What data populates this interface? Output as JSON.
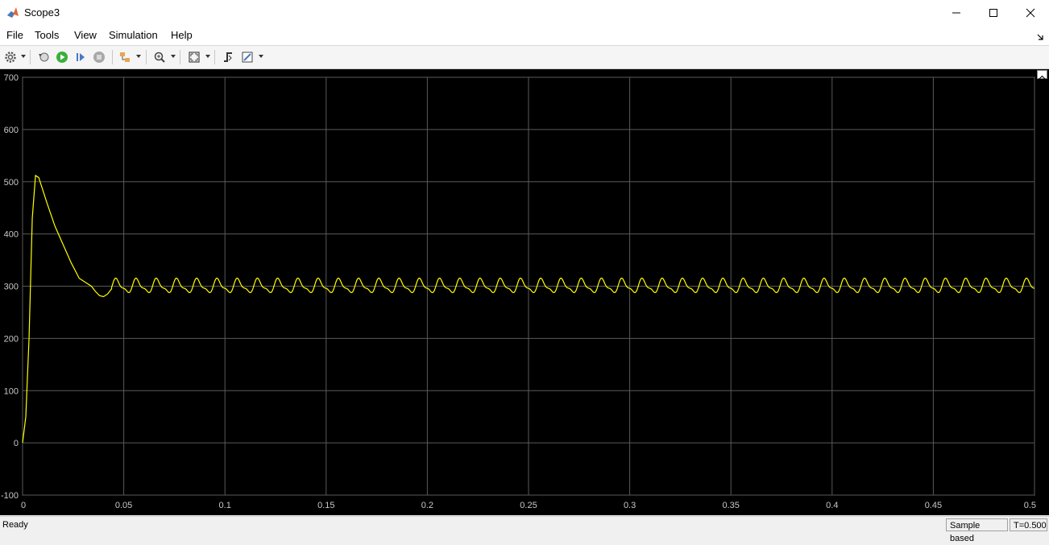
{
  "window": {
    "title": "Scope3"
  },
  "menu": [
    "File",
    "Tools",
    "View",
    "Simulation",
    "Help"
  ],
  "toolbar": {
    "icons": [
      "gear-icon",
      "restore-sim-icon",
      "run-icon",
      "step-forward-icon",
      "stop-icon",
      "highlight-icon",
      "zoom-in-icon",
      "autoscale-icon",
      "triggers-icon",
      "measurements-icon"
    ]
  },
  "status": {
    "text": "Ready",
    "sample_mode": "Sample based",
    "time": "T=0.500"
  },
  "colors": {
    "background": "#000000",
    "signal": "#ffff00",
    "grid": "#5a5a5a",
    "axis_text": "#c8c8c8"
  },
  "chart_data": {
    "type": "line",
    "title": "",
    "xlabel": "",
    "ylabel": "",
    "xlim": [
      0,
      0.5
    ],
    "ylim": [
      -100,
      700
    ],
    "xticks": [
      "0",
      "0.05",
      "0.1",
      "0.15",
      "0.2",
      "0.25",
      "0.3",
      "0.35",
      "0.4",
      "0.45",
      "0.5"
    ],
    "yticks": [
      "-100",
      "0",
      "100",
      "200",
      "300",
      "400",
      "500",
      "600",
      "700"
    ],
    "grid": true,
    "series": [
      {
        "color": "#ffff00",
        "startup": {
          "x": [
            0,
            0.0016,
            0.0032,
            0.0048,
            0.0064,
            0.008,
            0.012,
            0.016,
            0.02,
            0.024,
            0.028,
            0.032,
            0.034,
            0.036,
            0.038,
            0.04,
            0.042,
            0.044
          ],
          "y": [
            0,
            50,
            200,
            430,
            512,
            508,
            460,
            415,
            380,
            345,
            315,
            305,
            300,
            290,
            282,
            280,
            285,
            295
          ]
        },
        "steady_state": {
          "mean": 300,
          "amplitude": 13,
          "period": 0.01,
          "start": 0.044,
          "end": 0.5
        }
      }
    ]
  }
}
